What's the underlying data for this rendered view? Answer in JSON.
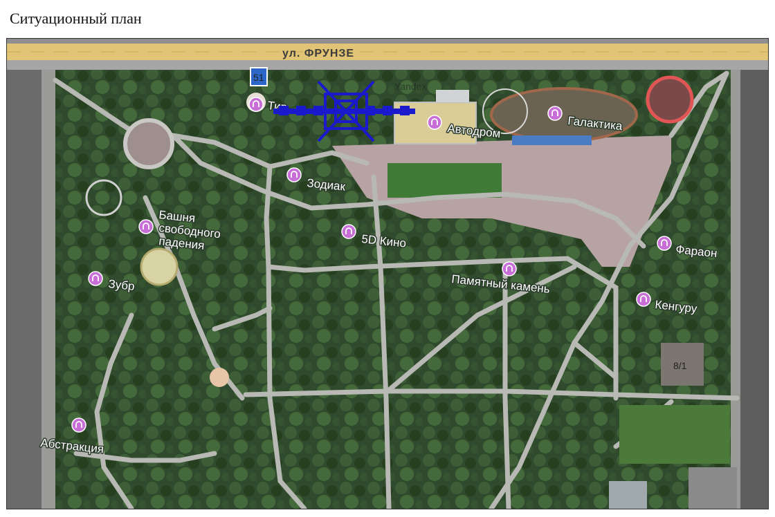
{
  "title": "Ситуационный план",
  "map": {
    "street_name": "ул. ФРУНЗЕ",
    "watermark": "Yandex",
    "bus_stop_sign": "51",
    "building_number": "8/1",
    "pois": [
      {
        "id": "tir",
        "label": "Тир",
        "icon": "attraction-icon"
      },
      {
        "id": "avtodrom",
        "label": "Автодром",
        "icon": "attraction-icon"
      },
      {
        "id": "galaktika",
        "label": "Галактика",
        "icon": "attraction-icon"
      },
      {
        "id": "zodiak",
        "label": "Зодиак",
        "icon": "attraction-icon"
      },
      {
        "id": "bashnya",
        "label": "Башня свободного падения",
        "lines": [
          "Башня",
          "свободного",
          "падения"
        ],
        "icon": "attraction-icon"
      },
      {
        "id": "kino",
        "label": "5D Кино",
        "icon": "cinema-icon"
      },
      {
        "id": "zubr",
        "label": "Зубр",
        "icon": "attraction-icon"
      },
      {
        "id": "faraon",
        "label": "Фараон",
        "icon": "attraction-icon"
      },
      {
        "id": "kamen",
        "label": "Памятный камень",
        "icon": "monument-icon"
      },
      {
        "id": "kenguru",
        "label": "Кенгуру",
        "icon": "attraction-icon"
      },
      {
        "id": "abstrakciya",
        "label": "Абстракция",
        "icon": "attraction-icon"
      }
    ],
    "marker": {
      "name": "planned-object-marker",
      "color": "#1a1acc"
    },
    "colors": {
      "street": "#e2c476",
      "foliage": "#2f4a2c",
      "paved": "#b7a3a4",
      "poi": "#c76fd6"
    }
  }
}
